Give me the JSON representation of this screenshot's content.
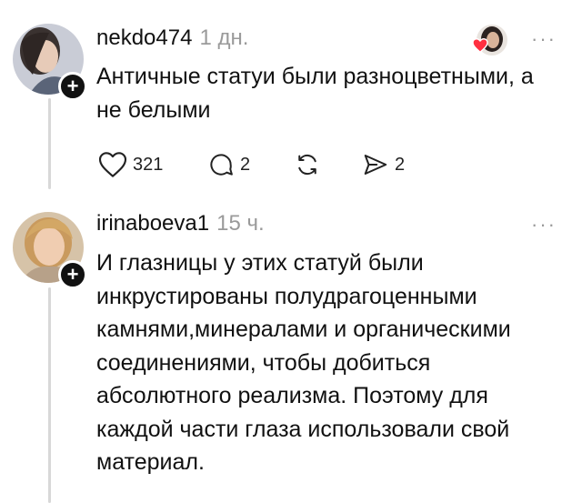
{
  "posts": [
    {
      "username": "nekdo474",
      "time": "1 дн.",
      "text": "Античные статуи были разноцветными, а не белыми",
      "likes": "321",
      "replies": "2",
      "shares": "2",
      "more": "···"
    },
    {
      "username": "irinaboeva1",
      "time": "15 ч.",
      "text": "И глазницы у этих статуй были инкрустированы полудрагоценными камнями,минералами и органическими соединениями, чтобы добиться абсолютного реализма. Поэтому для каждой части глаза использовали свой материал.",
      "more": "···"
    }
  ],
  "plus_symbol": "+",
  "colors": {
    "heart": "#ff3040",
    "muted": "#9a9a9a",
    "line": "#d8d8d8"
  }
}
